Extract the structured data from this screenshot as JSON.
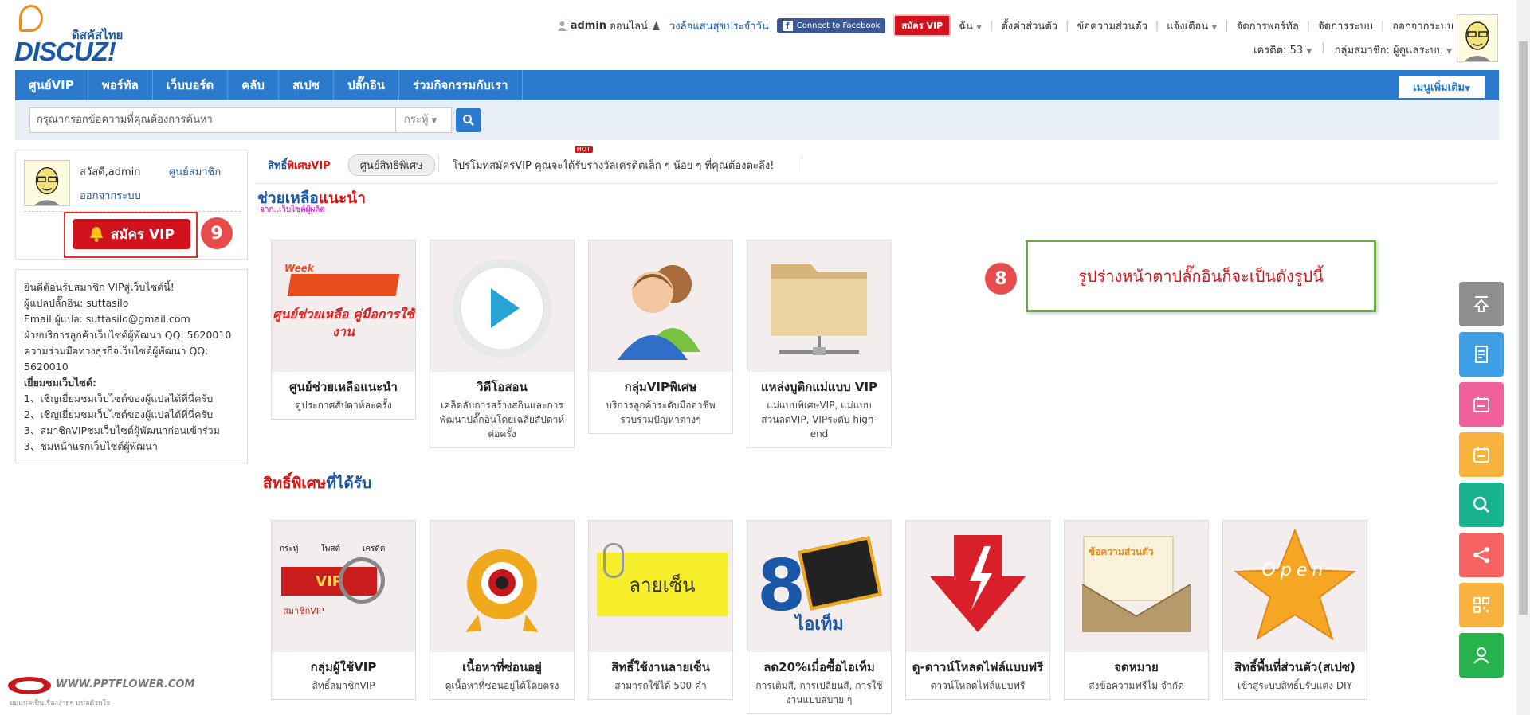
{
  "brand": {
    "thai_name": "ดิสคัสไทย",
    "logo_text": "DISCUZ!"
  },
  "topbar": {
    "username": "admin",
    "online": "ออนไลน์",
    "community_link": "วงล้อแสนสุขประจำวัน",
    "facebook_btn": "Connect to Facebook",
    "vip_btn": "สมัคร VIP",
    "links": [
      "ฉัน",
      "ตั้งค่าส่วนตัว",
      "ข้อความส่วนตัว",
      "แจ้งเตือน",
      "จัดการพอร์ทัล",
      "จัดการระบบ",
      "ออกจากระบบ"
    ],
    "credits": "เครดิต: 53",
    "group": "กลุ่มสมาชิก: ผู้ดูแลระบบ"
  },
  "nav": {
    "items": [
      "ศูนย์VIP",
      "พอร์ทัล",
      "เว็บบอร์ด",
      "คลับ",
      "สเปซ",
      "ปลั๊กอิน",
      "ร่วมกิจกรรมกับเรา"
    ],
    "more": "เมนูเพิ่มเติม"
  },
  "search": {
    "placeholder": "กรุณากรอกข้อความที่คุณต้องการค้นหา",
    "type": "กระทู้"
  },
  "sidebar": {
    "greeting": "สวัสดี,admin",
    "member_center": "ศูนย์สมาชิก",
    "logout": "ออกจากระบบ",
    "vip_join": "สมัคร VIP",
    "info_lines": [
      "ยินดีต้อนรับสมาชิก VIPสู่เว็บไซต์นี้!",
      "ผู้แปลปลั๊กอิน: suttasilo",
      "Email ผู้แปล: suttasilo@gmail.com",
      "ฝ่ายบริการลูกค้าเว็บไซต์ผู้พัฒนา QQ:  5620010",
      "ความร่วมมือทางธุรกิจเว็บไซต์ผู้พัฒนา QQ:",
      "5620010"
    ],
    "visit_title": "เยี่ยมชมเว็บไซต์:",
    "visit_lines": [
      "1、เชิญเยี่ยมชมเว็บไซต์ของผู้แปลได้ที่นี่ครับ",
      "2、เชิญเยี่ยมชมเว็บไซต์ของผู้แปลได้ที่นี่ครับ",
      "3、สมาชิกVIPชมเว็บไซต์ผู้พัฒนาก่อนเข้าร่วม",
      "3、ชมหน้าแรกเว็บไซต์ผู้พัฒนา"
    ]
  },
  "tabs": {
    "vip_rights_a": "สิทธิ์",
    "vip_rights_b": "พิเศษVIP",
    "center": "ศูนย์สิทธิพิเศษ",
    "promo": "โปรโมทสมัครVIP คุณจะได้รับรางวัลเครดิตเล็ก ๆ น้อย ๆ ที่คุณต้องตะลึง!",
    "hot": "HOT"
  },
  "section1": {
    "title_a": "ช่วยเหลือ",
    "title_b": "แนะนำ",
    "sub": "จาก..เว็บไซต์ผู้ผลิต"
  },
  "section2": {
    "title_a": "สิทธิ์พิเศษ",
    "title_b": "ที่ได้รับ"
  },
  "help_cards": [
    {
      "name": "ศูนย์ช่วยเหลือแนะนำ",
      "desc": "ดูประกาศสัปดาห์ละครั้ง",
      "img_text": "ศูนย์ช่วยเหลือ คู่มือการใช้งาน"
    },
    {
      "name": "วิดีโอสอน",
      "desc": "เคล็ดลับการสร้างสกินและการพัฒนาปลั๊กอินโดยเฉลี่ยสัปดาห์ต่อครั้ง"
    },
    {
      "name": "กลุ่มVIPพิเศษ",
      "desc": "บริการลูกค้าระดับมืออาชีพ รวบรวมปัญหาต่างๆ"
    },
    {
      "name": "แหล่งบูติกแม่แบบ VIP",
      "desc": "แม่แบบพิเศษVIP, แม่แบบส่วนลดVIP, VIPระดับ high-end"
    }
  ],
  "privilege_cards": [
    {
      "name": "กลุ่มผู้ใช้VIP",
      "desc": "สิทธิ์สมาชิกVIP"
    },
    {
      "name": "เนื้อหาที่ซ่อนอยู่",
      "desc": "ดูเนื้อหาที่ซ่อนอยู่ได้โดยตรง"
    },
    {
      "name": "สิทธิ์ใช้งานลายเซ็น",
      "desc": "สามารถใช้ได้ 500 คำ",
      "img_text": "ลายเซ็น"
    },
    {
      "name": "ลด20%เมื่อซื้อไอเท็ม",
      "desc": "การเติมสี, การเปลี่ยนสี, การใช้งานแบบสบาย ๆ",
      "img_text": "ไอเท็ม"
    },
    {
      "name": "ดู-ดาวน์โหลดไฟล์แบบฟรี",
      "desc": "ดาวน์โหลดไฟล์แบบฟรี"
    },
    {
      "name": "จดหมาย",
      "desc": "ส่งข้อความฟรีไม่ จำกัด",
      "img_text": "ข้อความส่วนตัว"
    },
    {
      "name": "สิทธิ์พื้นที่ส่วนตัว(สเปซ)",
      "desc": "เข้าสู่ระบบสิทธิ์ปรับแต่ง DIY",
      "img_text": "Open"
    }
  ],
  "vip_card_img": {
    "tab1": "กระทู้",
    "tab2": "โพสต์",
    "tab3": "เครดิต",
    "label": "VIP",
    "sub": "สมาชิกVIP"
  },
  "annotations": {
    "badge8": "8",
    "badge9": "9",
    "note": "รูปร่างหน้าตาปลั๊กอินก็จะเป็นดังรูปนี้"
  },
  "watermark": {
    "title": "WWW.PPTFLOWER.COM",
    "sub": "ผมแปลเป็นเรื่องง่ายๆ แปลด้วยใจ"
  },
  "colors": {
    "nav": "#2b7acb",
    "brand_blue": "#1a57a6",
    "red": "#d1111b",
    "note_border": "#6aa842"
  },
  "float_buttons": [
    {
      "icon": "back-to-top-icon",
      "color": "#8e8e8e"
    },
    {
      "icon": "document-icon",
      "color": "#3fa0e8"
    },
    {
      "icon": "calendar-icon",
      "color": "#f0609a"
    },
    {
      "icon": "calendar-alt-icon",
      "color": "#f7b33e"
    },
    {
      "icon": "search-icon",
      "color": "#17b38f"
    },
    {
      "icon": "share-icon",
      "color": "#f56363"
    },
    {
      "icon": "qrcode-icon",
      "color": "#f7b33e"
    },
    {
      "icon": "contact-icon",
      "color": "#27b34b"
    }
  ]
}
